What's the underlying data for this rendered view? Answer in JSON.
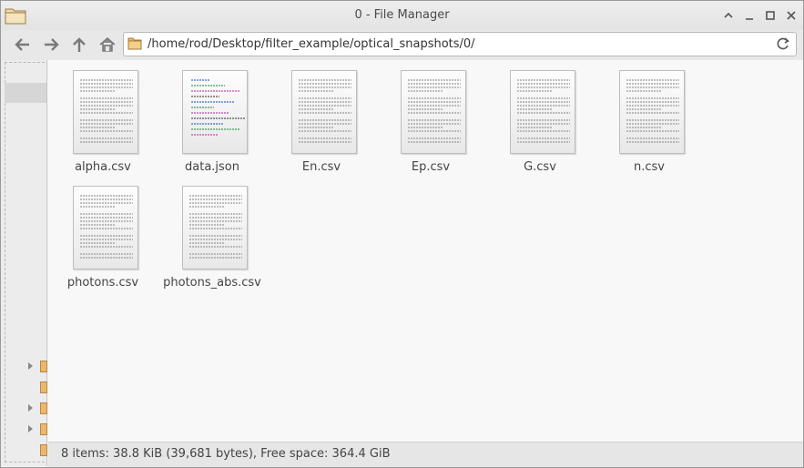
{
  "window": {
    "title": "0 - File Manager",
    "minimize_label": "⌃",
    "close_label": "✕"
  },
  "toolbar": {
    "back_icon": "back-arrow-icon",
    "forward_icon": "forward-arrow-icon",
    "up_icon": "up-arrow-icon",
    "home_icon": "home-icon"
  },
  "location": {
    "path": "/home/rod/Desktop/filter_example/optical_snapshots/0/"
  },
  "files": [
    {
      "name": "alpha.csv",
      "kind": "text"
    },
    {
      "name": "data.json",
      "kind": "code"
    },
    {
      "name": "En.csv",
      "kind": "text"
    },
    {
      "name": "Ep.csv",
      "kind": "text"
    },
    {
      "name": "G.csv",
      "kind": "text"
    },
    {
      "name": "n.csv",
      "kind": "text"
    },
    {
      "name": "photons.csv",
      "kind": "text"
    },
    {
      "name": "photons_abs.csv",
      "kind": "text"
    }
  ],
  "status": {
    "text": "8 items: 38.8 KiB (39,681 bytes), Free space: 364.4 GiB"
  },
  "colors": {
    "folder": "#e9b86a",
    "accent": "#4a4a4a"
  }
}
